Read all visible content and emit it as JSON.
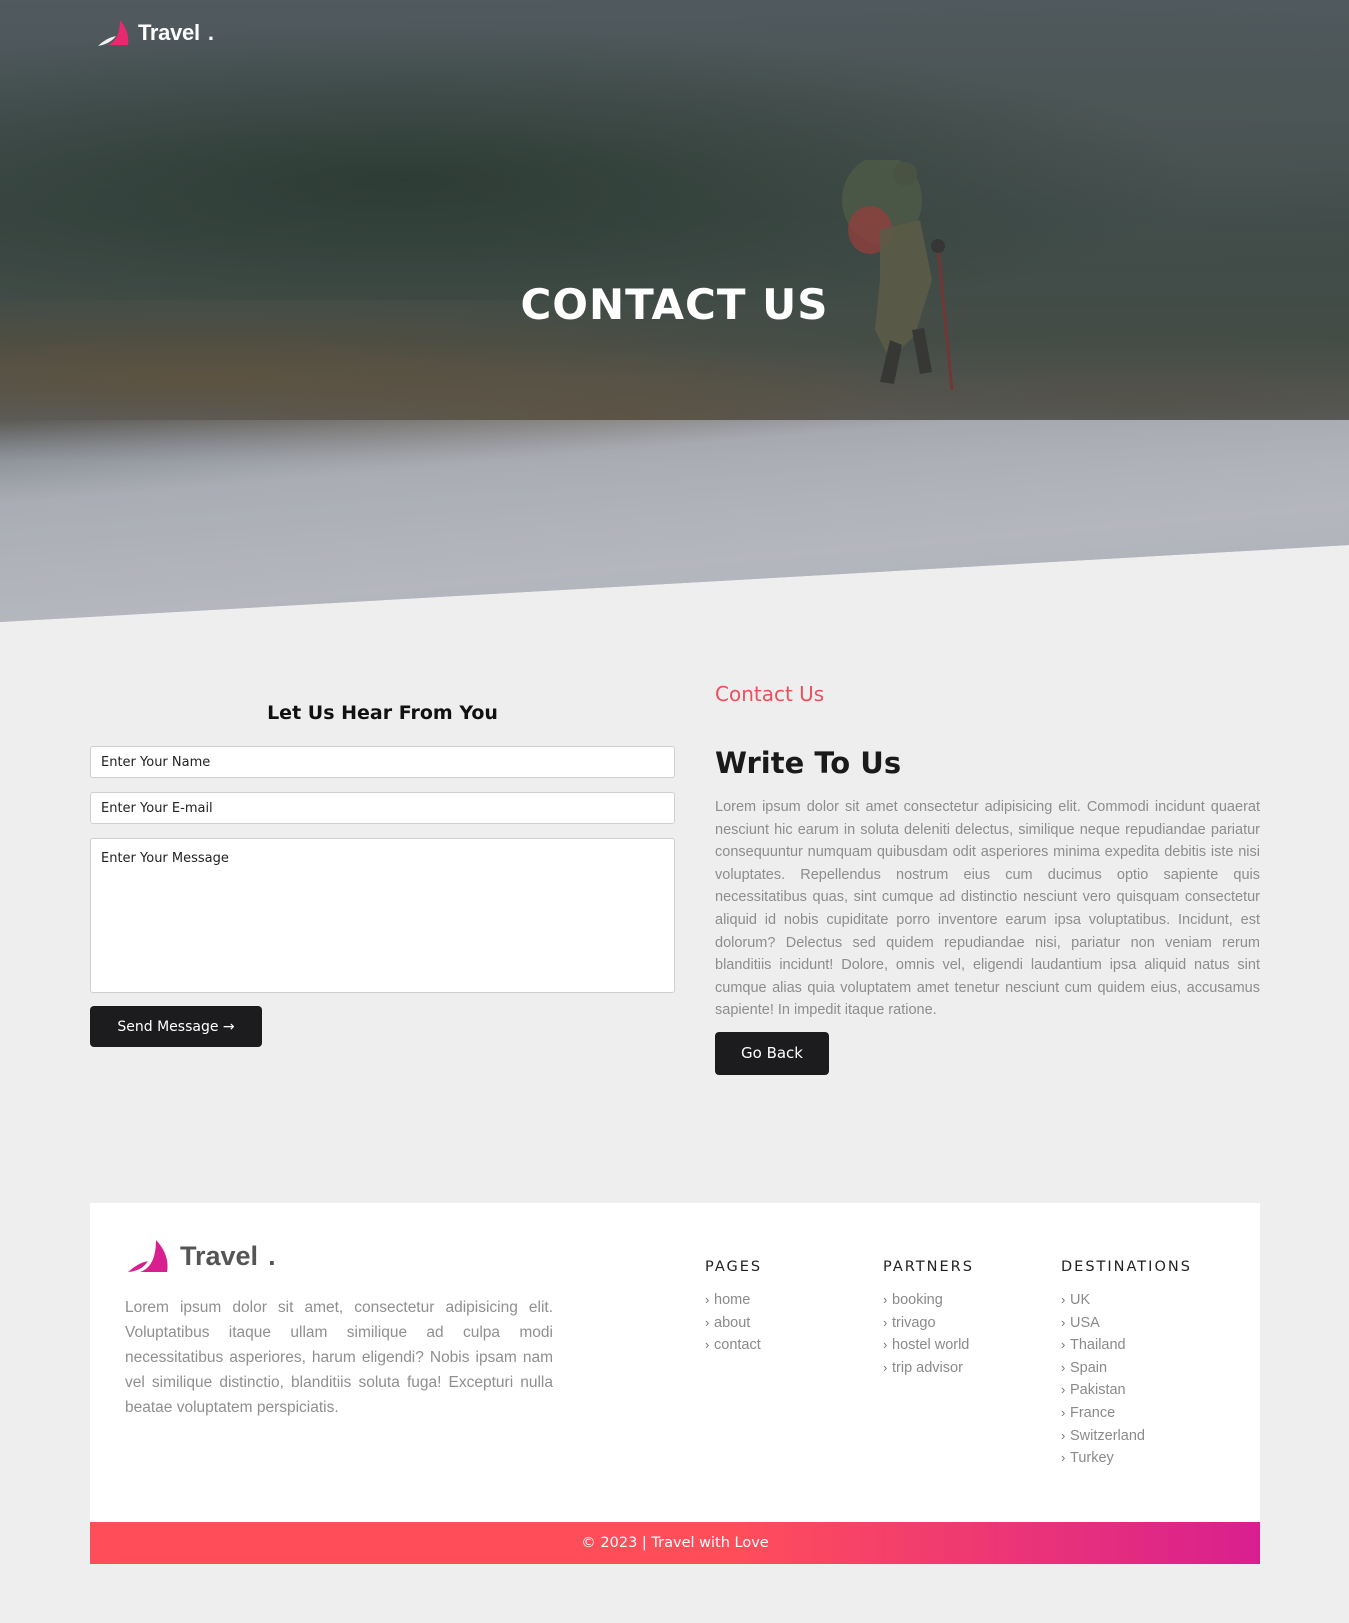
{
  "brand": {
    "name": "Travel",
    "dot": ".",
    "accent": "#ee4e5e",
    "gradient_end": "#d91f8f"
  },
  "hero": {
    "title": "CONTACT US"
  },
  "form": {
    "heading": "Let Us Hear From You",
    "name_placeholder": "Enter Your Name",
    "email_placeholder": "Enter Your E-mail",
    "message_placeholder": "Enter Your Message",
    "send_label": "Send Message →"
  },
  "info": {
    "subtitle": "Contact Us",
    "title": "Write To Us",
    "text": "Lorem ipsum dolor sit amet consectetur adipisicing elit. Commodi incidunt quaerat nesciunt hic earum in soluta deleniti delectus, similique neque repudiandae pariatur consequuntur numquam quibusdam odit asperiores minima expedita debitis iste nisi voluptates. Repellendus nostrum eius cum ducimus optio sapiente quis necessitatibus quas, sint cumque ad distinctio nesciunt vero quisquam consectetur aliquid id nobis cupiditate porro inventore earum ipsa voluptatibus. Incidunt, est dolorum? Delectus sed quidem repudiandae nisi, pariatur non veniam rerum blanditiis incidunt! Dolore, omnis vel, eligendi laudantium ipsa aliquid natus sint cumque alias quia voluptatem amet tenetur nesciunt cum quidem eius, accusamus sapiente! In impedit itaque ratione.",
    "back_label": "Go Back"
  },
  "footer": {
    "description": "Lorem ipsum dolor sit amet, consectetur adipisicing elit. Voluptatibus itaque ullam similique ad culpa modi necessitatibus asperiores, harum eligendi? Nobis ipsam nam vel similique distinctio, blanditiis soluta fuga! Excepturi nulla beatae voluptatem perspiciatis.",
    "pages": {
      "heading": "PAGES",
      "items": [
        "home",
        "about",
        "contact"
      ]
    },
    "partners": {
      "heading": "PARTNERS",
      "items": [
        "booking",
        "trivago",
        "hostel world",
        "trip advisor"
      ]
    },
    "destinations": {
      "heading": "DESTINATIONS",
      "items": [
        "UK",
        "USA",
        "Thailand",
        "Spain",
        "Pakistan",
        "France",
        "Switzerland",
        "Turkey"
      ]
    },
    "copyright": "© 2023 | Travel with Love"
  }
}
